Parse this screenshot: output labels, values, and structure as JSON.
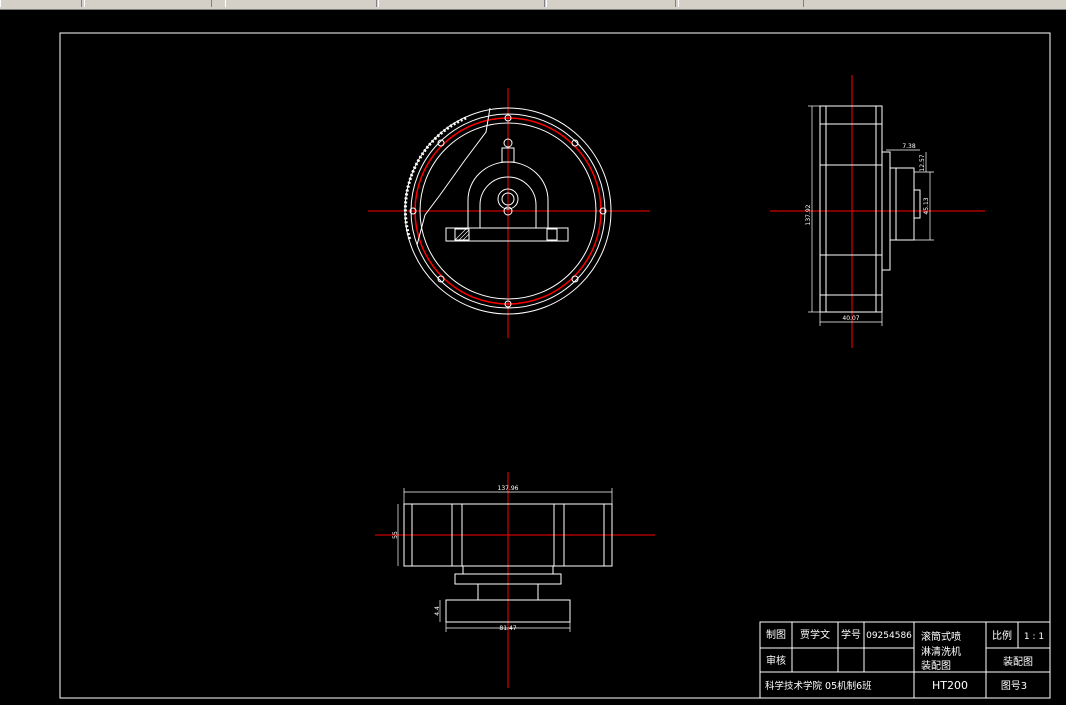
{
  "colors": {
    "background": "#000000",
    "line": "#ffffff",
    "centerline": "#ff0000",
    "window_chrome": "#d4d0c8"
  },
  "dimensions": {
    "front_vertical": "137.92",
    "side_width": "40.07",
    "side_top_offset": "7.38",
    "side_step": "12.57",
    "side_hub": "45.13",
    "bottom_overall": "137.96",
    "bottom_base": "81.47",
    "bottom_left_height": "55",
    "bottom_small": "4.4"
  },
  "title_block": {
    "drawn_by_label": "制图",
    "drawn_by_name": "贾学文",
    "student_id_label": "学号",
    "student_id": "09254586",
    "reviewed_label": "审核",
    "title_line1": "滚筒式喷",
    "title_line2": "淋清洗机",
    "title_line3": "装配图",
    "scale_label": "比例",
    "scale_value": "1 : 1",
    "drawing_type": "装配图",
    "school": "科学技术学院  05机制6班",
    "material": "HT200",
    "drawing_number": "图号3"
  }
}
